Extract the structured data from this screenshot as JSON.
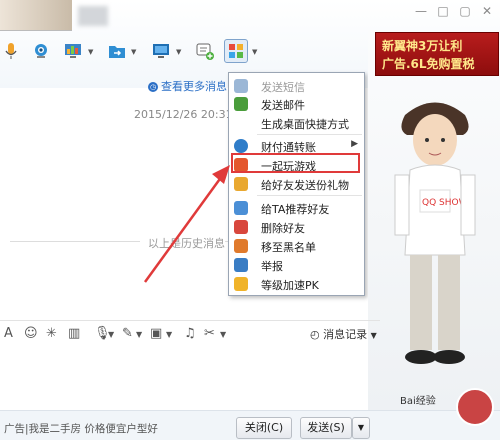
{
  "window": {
    "controls": [
      "—",
      "□",
      "✕"
    ]
  },
  "toolbar": {
    "items": [
      "voice-call",
      "video-call",
      "screen-share",
      "file-transfer",
      "remote-assist",
      "create-group",
      "app-center"
    ]
  },
  "chat": {
    "more_messages": "查看更多消息",
    "timestamp": "2015/12/26 20:31:",
    "history_note": "以上是历史消息"
  },
  "context_menu": {
    "items": [
      {
        "label": "发送短信",
        "disabled": true,
        "icon": "sms-icon"
      },
      {
        "label": "发送邮件",
        "disabled": false,
        "icon": "email-icon"
      },
      {
        "label": "生成桌面快捷方式",
        "disabled": false,
        "icon": ""
      },
      {
        "label": "财付通转账",
        "disabled": false,
        "icon": "tenpay-icon",
        "submenu": true
      },
      {
        "label": "一起玩游戏",
        "disabled": false,
        "icon": "game-icon"
      },
      {
        "label": "给好友发送份礼物",
        "disabled": false,
        "icon": "gift-icon"
      },
      {
        "label": "给TA推荐好友",
        "disabled": false,
        "icon": "recommend-icon"
      },
      {
        "label": "删除好友",
        "disabled": false,
        "icon": "delete-friend-icon"
      },
      {
        "label": "移至黑名单",
        "disabled": false,
        "icon": "blacklist-icon"
      },
      {
        "label": "举报",
        "disabled": false,
        "icon": "report-icon"
      },
      {
        "label": "等级加速PK",
        "disabled": false,
        "icon": "level-icon"
      }
    ]
  },
  "message_toolbar": {
    "record_label": "消息记录"
  },
  "footer": {
    "ad_text": "广告|我是二手房 价格便宜户型好",
    "close_label": "关闭(C)",
    "send_label": "发送(S)"
  },
  "side_ad": {
    "line1": "新翼神3万让利",
    "line2": "广告.6L免购置税"
  },
  "avatar_shirt_text": "QQ SHOW",
  "watermark": "Bai经验"
}
